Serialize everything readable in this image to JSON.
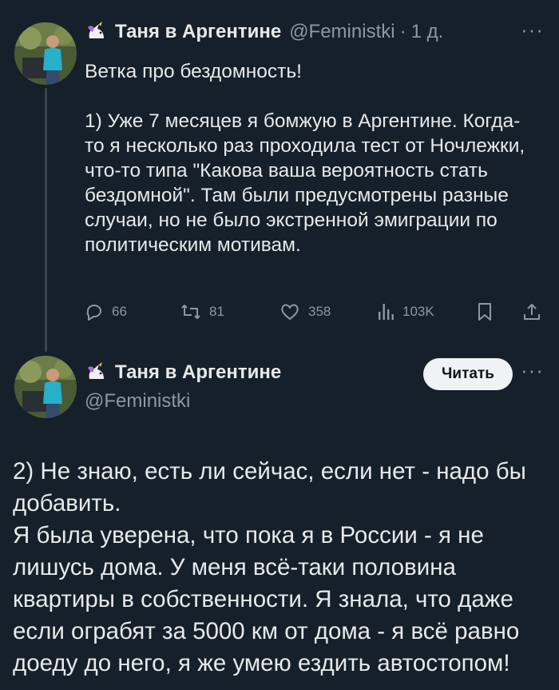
{
  "tweet1": {
    "display_name": "Таня в Аргентине",
    "handle": "@Feminis​tki",
    "separator": "·",
    "time": "1 д.",
    "more": "···",
    "text": "Ветка про бездомность!\n\n1) Уже 7 месяцев я бомжую в Аргентине. Когда-то я несколько раз проходила тест от Ночлежки, что-то типа \"Какова ваша вероятность стать бездомной\". Там были предусмотрены разные случаи, но не было экстренной эмиграции по политическим мотивам.",
    "actions": {
      "replies": "66",
      "retweets": "81",
      "likes": "358",
      "views": "103K"
    }
  },
  "tweet2": {
    "display_name": "Таня в Аргентине",
    "handle": "@Feminis​tki",
    "read_button": "Читать",
    "more": "···",
    "text": "2) Не знаю, есть ли сейчас, если нет - надо бы добавить.\n Я была уверена, что пока я в России - я не лишусь дома. У меня всё-таки половина квартиры в собственности. Я знала, что даже если ограбят за 5000 км от дома - я всё равно доеду до него, я же умею ездить автостопом!"
  },
  "colors": {
    "background": "#15202b",
    "text": "#e7e9ea",
    "secondary": "#8b98a5",
    "thread_line": "#38444d"
  }
}
